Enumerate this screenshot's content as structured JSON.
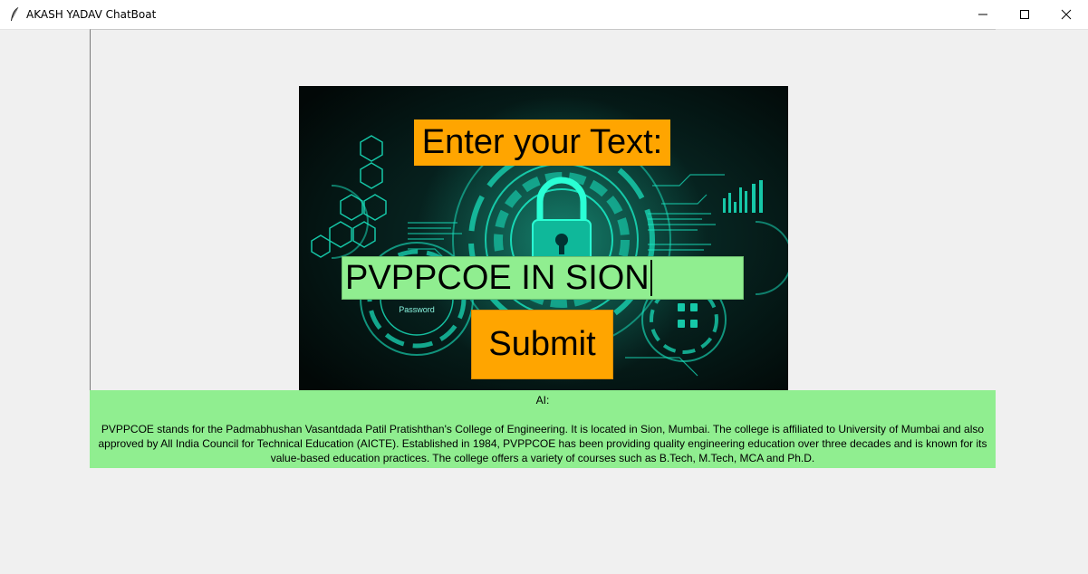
{
  "window": {
    "title": "AKASH YADAV ChatBoat",
    "minimize_label": "Minimize",
    "maximize_label": "Maximize",
    "close_label": "Close"
  },
  "prompt": {
    "label": "Enter your Text:"
  },
  "input": {
    "value": "PVPPCOE IN SION"
  },
  "submit": {
    "label": "Submit"
  },
  "response": {
    "label": "AI:",
    "text": "PVPPCOE stands for the Padmabhushan Vasantdada Patil Pratishthan's College of Engineering. It is located in Sion, Mumbai. The college is affiliated to University of Mumbai and also approved by All India Council for Technical Education (AICTE). Established in 1984, PVPPCOE has been providing quality engineering education over three decades and is known for its value-based education practices. The college offers a variety of courses such as B.Tech, M.Tech, MCA and Ph.D."
  },
  "background": {
    "password_caption": "Password"
  },
  "colors": {
    "accent_orange": "#ffa500",
    "accent_green": "#90ee90",
    "window_bg": "#f0f0f0",
    "glow": "#19e6c1"
  }
}
